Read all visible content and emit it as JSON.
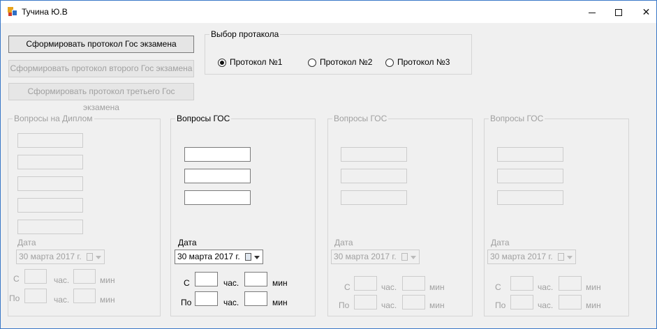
{
  "window": {
    "title": "Тучина Ю.В"
  },
  "buttons": {
    "form_gos": "Сформировать протокол Гос экзамена",
    "form_second": "Сформировать протокол второго Гос экзамена",
    "form_third": "Сформировать протокол третьего Гос экзамена"
  },
  "protocol_select": {
    "legend": "Выбор протакола",
    "options": [
      {
        "label": "Протокол №1",
        "selected": true
      },
      {
        "label": "Протокол №2",
        "selected": false
      },
      {
        "label": "Протокол №3",
        "selected": false
      }
    ]
  },
  "groups": [
    {
      "legend": "Вопросы на Диплом",
      "enabled": false,
      "fields": 5,
      "date_label": "Дата",
      "date": "30   марта   2017 г.",
      "from_label": "С",
      "to_label": "По",
      "hours": "час.",
      "minutes": "мин"
    },
    {
      "legend": "Вопросы ГОС",
      "enabled": true,
      "fields": 3,
      "date_label": "Дата",
      "date": "30   марта   2017 г.",
      "from_label": "С",
      "to_label": "По",
      "hours": "час.",
      "minutes": "мин"
    },
    {
      "legend": "Вопросы ГОС",
      "enabled": false,
      "fields": 3,
      "date_label": "Дата",
      "date": "30   марта   2017 г.",
      "from_label": "С",
      "to_label": "По",
      "hours": "час.",
      "minutes": "мин"
    },
    {
      "legend": "Вопросы ГОС",
      "enabled": false,
      "fields": 3,
      "date_label": "Дата",
      "date": "30   марта   2017 г.",
      "from_label": "С",
      "to_label": "По",
      "hours": "час.",
      "minutes": "мин"
    }
  ]
}
